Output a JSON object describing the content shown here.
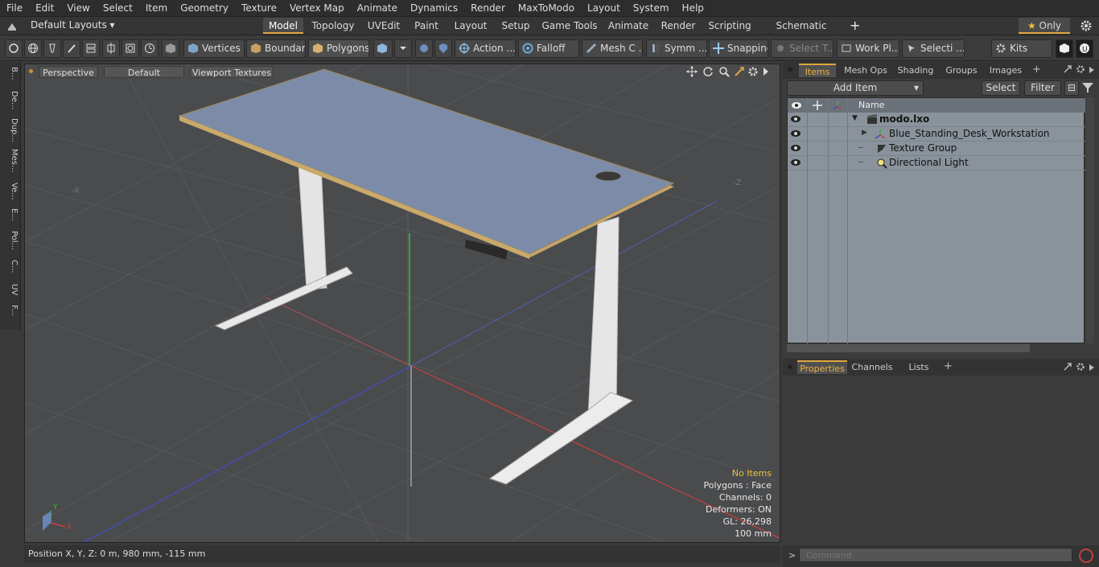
{
  "menu": [
    "File",
    "Edit",
    "View",
    "Select",
    "Item",
    "Geometry",
    "Texture",
    "Vertex Map",
    "Animate",
    "Dynamics",
    "Render",
    "MaxToModo",
    "Layout",
    "System",
    "Help"
  ],
  "layouts": {
    "dropdown": "Default Layouts",
    "tabs": [
      "Model",
      "Topology",
      "UVEdit",
      "Paint",
      "Layout",
      "Setup",
      "Game Tools",
      "Animate",
      "Render",
      "Scripting",
      "Schematic Fusion"
    ],
    "only_label": "Only"
  },
  "toolbar": {
    "vertices": "Vertices",
    "boundary": "Boundary",
    "polygons": "Polygons",
    "action": "Action",
    "falloff": "Falloff",
    "mesh": "Mesh C ...",
    "symm": "Symm ...",
    "snapping": "Snapping",
    "select_t": "Select T...",
    "work_pl": "Work Pl...",
    "selecti": "Selecti ...",
    "kits": "Kits"
  },
  "left_tabs": [
    "B...",
    "De...",
    "Dup...",
    "Mes...",
    "Ve...",
    "E...",
    "Pol...",
    "C...",
    "UV",
    "F..."
  ],
  "viewport": {
    "view": "Perspective",
    "shading": "Default",
    "textures": "Viewport Textures",
    "axis_x_label": "X",
    "axis_y_label": "Y",
    "status": {
      "items": "No Items",
      "polygons": "Polygons : Face",
      "channels": "Channels: 0",
      "deformers": "Deformers: ON",
      "gl": "GL: 26,298",
      "scale": "100 mm"
    }
  },
  "position_readout": "Position X, Y, Z:   0 m, 980 mm, -115 mm",
  "items_panel": {
    "tabs": [
      "Items",
      "Mesh Ops",
      "Shading",
      "Groups",
      "Images"
    ],
    "add_item": "Add Item",
    "select": "Select",
    "filter": "Filter",
    "name_header": "Name",
    "rows": [
      {
        "name": "modo.lxo"
      },
      {
        "name": "Blue_Standing_Desk_Workstation"
      },
      {
        "name": "Texture Group"
      },
      {
        "name": "Directional Light"
      }
    ]
  },
  "properties_panel": {
    "tabs": [
      "Properties",
      "Channels",
      "Lists"
    ]
  },
  "command": {
    "placeholder": "Command"
  },
  "colors": {
    "accent": "#e0a640",
    "desk_top": "#7c8ca8",
    "viewport_bg": "#4a4b4d"
  }
}
